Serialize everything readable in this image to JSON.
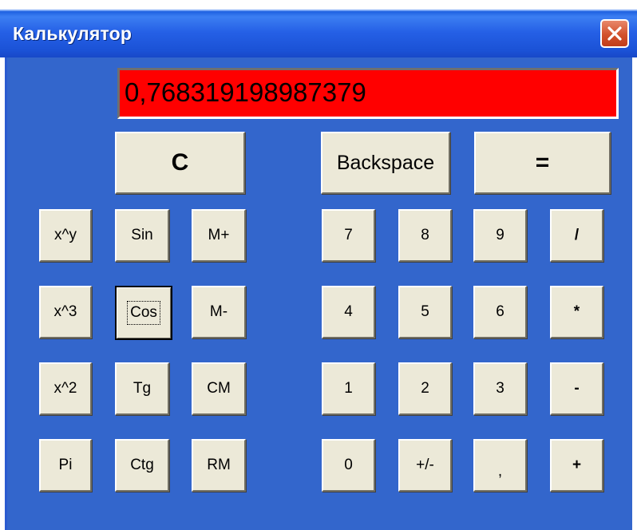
{
  "window": {
    "title": "Калькулятор",
    "close_label": ""
  },
  "display": {
    "value": "0,768319198987379"
  },
  "buttons": {
    "clear": "C",
    "backspace": "Backspace",
    "equals": "=",
    "pow_xy": "x^y",
    "sin": "Sin",
    "mplus": "M+",
    "d7": "7",
    "d8": "8",
    "d9": "9",
    "div": "/",
    "cube": "x^3",
    "cos": "Cos",
    "mminus": "M-",
    "d4": "4",
    "d5": "5",
    "d6": "6",
    "mul": "*",
    "square": "x^2",
    "tg": "Tg",
    "cm": "CM",
    "d1": "1",
    "d2": "2",
    "d3": "3",
    "sub": "-",
    "pi": "Pi",
    "ctg": "Ctg",
    "rm": "RM",
    "d0": "0",
    "sign": "+/-",
    "comma": ",",
    "add": "+"
  }
}
